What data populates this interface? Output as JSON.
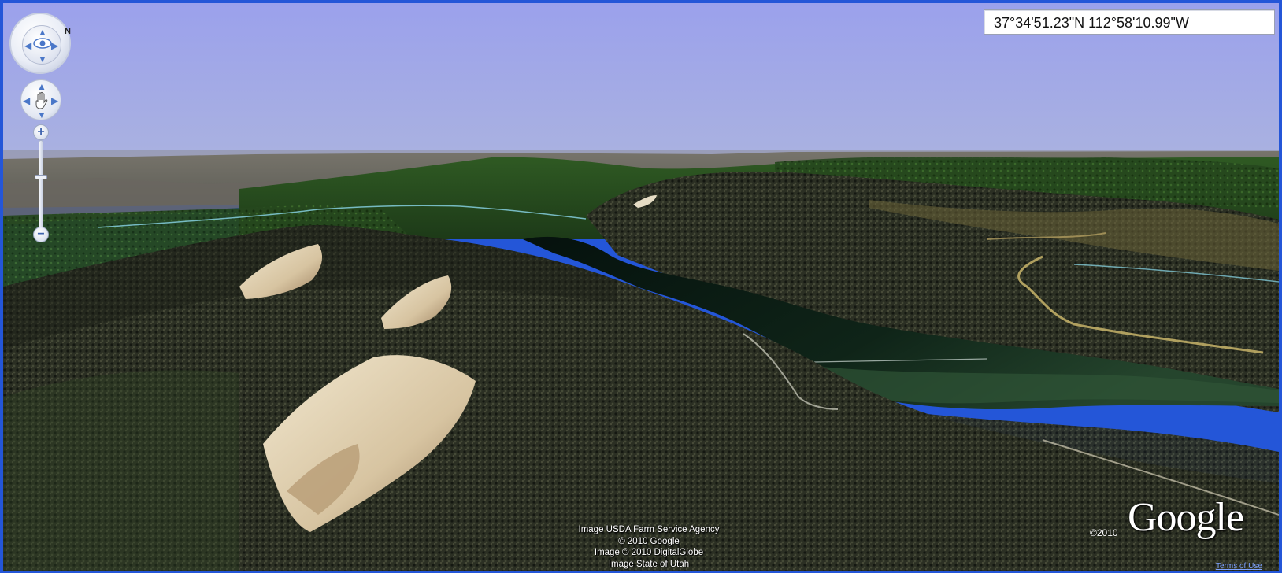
{
  "coordinates": "37°34'51.23\"N 112°58'10.99\"W",
  "compass": {
    "north_label": "N"
  },
  "zoom": {
    "plus": "+",
    "minus": "−"
  },
  "attribution": [
    "Image USDA Farm Service Agency",
    "© 2010 Google",
    "Image © 2010 DigitalGlobe",
    "Image State of Utah"
  ],
  "copyright": "©2010",
  "logo": "Google",
  "terms_link": "Terms of Use",
  "colors": {
    "sky_top": "#9fa5ea",
    "sky_horizon": "#a8b0e2",
    "lake": "#0d1a14",
    "hillside": "#2a2e22",
    "distant_plain": "#6f6d66",
    "frame": "#2456d8"
  }
}
